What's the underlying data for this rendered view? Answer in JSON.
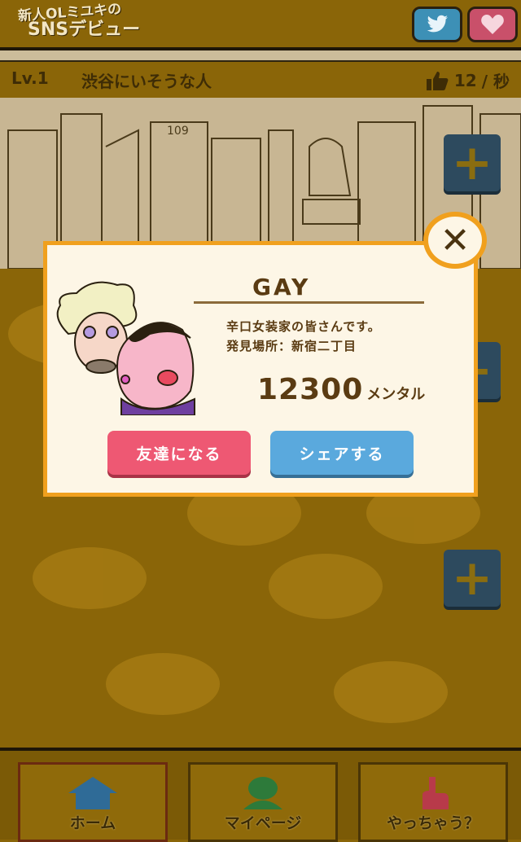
{
  "header": {
    "logo_line1": "新人OLミユキの",
    "logo_line2": "SNSデビュー"
  },
  "status": {
    "level": "Lv.1",
    "place": "渋谷にいそうな人",
    "likes_per_sec": "12",
    "per_sec_unit": "/ 秒"
  },
  "modal": {
    "name": "GAY",
    "description": "辛口女装家の皆さんです。",
    "location": "発見場所：新宿二丁目",
    "score": "12300",
    "score_unit": "メンタル",
    "friend_button": "友達になる",
    "share_button": "シェアする",
    "close_symbol": "✕"
  },
  "plus_symbol": "+",
  "nav": {
    "items": [
      {
        "label": "ホーム",
        "icon": "house-icon"
      },
      {
        "label": "マイページ",
        "icon": "person-icon"
      },
      {
        "label": "やっちゃう？",
        "icon": "pointing-hand-icon"
      }
    ]
  },
  "colors": {
    "dim_background": "#8a6508",
    "modal_border": "#f0a01e",
    "friend_button": "#ee5873",
    "share_button": "#5aa9dd"
  }
}
